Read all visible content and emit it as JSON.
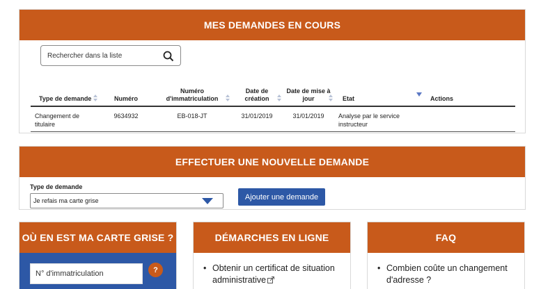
{
  "requests": {
    "title": "MES DEMANDES EN COURS",
    "search_placeholder": "Rechercher dans la liste",
    "columns": [
      "Type de demande",
      "Numéro",
      "Numéro d'immatriculation",
      "Date de création",
      "Date de mise à jour",
      "Etat",
      "Actions"
    ],
    "rows": [
      {
        "type": "Changement de titulaire",
        "numero": "9634932",
        "immat": "EB-018-JT",
        "creation": "31/01/2019",
        "maj": "31/01/2019",
        "etat": "Analyse par le service instructeur",
        "actions": ""
      }
    ]
  },
  "new_request": {
    "title": "EFFECTUER UNE NOUVELLE DEMANDE",
    "type_label": "Type de demande",
    "selected_type": "Je refais ma carte grise",
    "add_button": "Ajouter une demande"
  },
  "cards": {
    "status": {
      "title": "OÙ EN EST MA CARTE GRISE ?",
      "immat_placeholder": "N° d'immatriculation",
      "help": "?"
    },
    "online": {
      "title": "DÉMARCHES EN LIGNE",
      "items": [
        "Obtenir un certificat de situation administrative"
      ]
    },
    "faq": {
      "title": "FAQ",
      "items": [
        "Combien coûte un changement d'adresse ?"
      ]
    }
  },
  "colors": {
    "header_orange": "#c85a1b",
    "primary_blue": "#2d58a6"
  }
}
